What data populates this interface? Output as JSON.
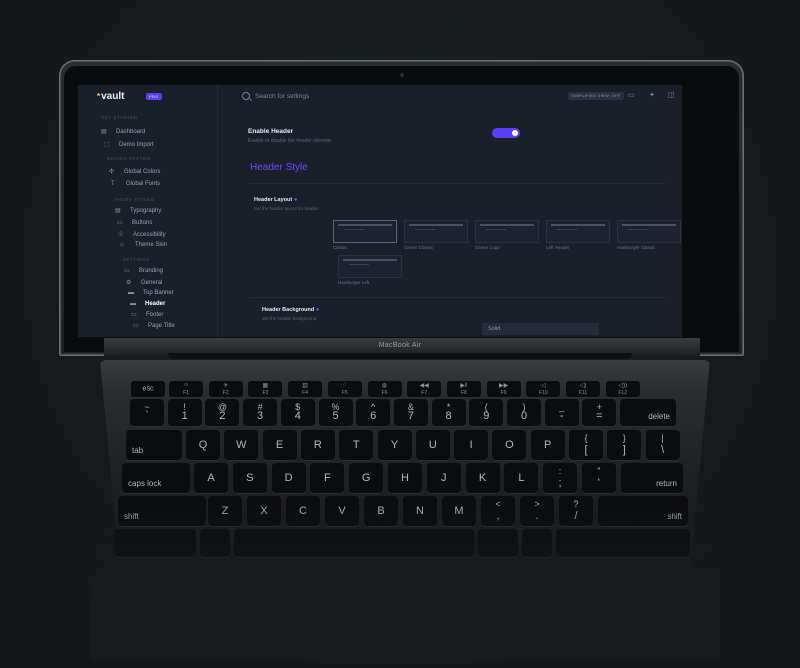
{
  "device": {
    "model_label": "MacBook Air"
  },
  "app": {
    "logo": "vault",
    "logo_star": "*",
    "badge": "PRO",
    "accent": "#5b3ff5"
  },
  "sidebar": {
    "sections": [
      {
        "title": "GET STARTED",
        "items": [
          {
            "label": "Dashboard",
            "icon": "dashboard-icon"
          },
          {
            "label": "Demo Import",
            "icon": "import-icon"
          }
        ]
      },
      {
        "title": "DESIGN SYSTEM",
        "items": [
          {
            "label": "Global Colors",
            "icon": "palette-icon"
          },
          {
            "label": "Global Fonts",
            "icon": "font-icon"
          }
        ]
      },
      {
        "title": "THEME STYLES",
        "items": [
          {
            "label": "Typography",
            "icon": "typography-icon"
          },
          {
            "label": "Buttons",
            "icon": "button-icon"
          },
          {
            "label": "Accessibility",
            "icon": "accessibility-icon"
          },
          {
            "label": "Theme Skin",
            "icon": "skin-icon"
          }
        ]
      },
      {
        "title": "SETTINGS",
        "items": [
          {
            "label": "Branding",
            "icon": "branding-icon"
          },
          {
            "label": "General",
            "icon": "general-icon"
          },
          {
            "label": "Top Banner",
            "icon": "banner-icon"
          },
          {
            "label": "Header",
            "icon": "header-icon",
            "active": true
          },
          {
            "label": "Footer",
            "icon": "footer-icon"
          },
          {
            "label": "Page Title",
            "icon": "page-title-icon"
          }
        ]
      }
    ]
  },
  "topbar": {
    "search_placeholder": "Search for settings",
    "simplified_view": "SIMPLIFIED VIEW: OFF"
  },
  "content": {
    "enable_header": {
      "label": "Enable Header",
      "desc": "Enable or disable the header sitewide",
      "on": true
    },
    "section_title": "Header Style",
    "header_layout": {
      "label": "Header Layout",
      "desc": "Set the header layout for header"
    },
    "layouts": [
      "Classic",
      "Center Classic",
      "Center Logo",
      "Left Header",
      "Hamburger Classic",
      "Hamburger Center",
      "Hamburger Left"
    ],
    "header_background": {
      "label": "Header Background",
      "desc": "Set the header background",
      "value": "Solid"
    }
  },
  "keyboard": {
    "function_row": [
      {
        "label": "esc"
      },
      {
        "label": "F1",
        "icon": "brightness-down-icon"
      },
      {
        "label": "F2",
        "icon": "brightness-up-icon"
      },
      {
        "label": "F3",
        "icon": "mission-control-icon"
      },
      {
        "label": "F4",
        "icon": "launchpad-icon"
      },
      {
        "label": "F5",
        "icon": "keyboard-light-down-icon"
      },
      {
        "label": "F6",
        "icon": "keyboard-light-up-icon"
      },
      {
        "label": "F7",
        "icon": "rewind-icon"
      },
      {
        "label": "F8",
        "icon": "play-pause-icon"
      },
      {
        "label": "F9",
        "icon": "fast-forward-icon"
      },
      {
        "label": "F10",
        "icon": "mute-icon"
      },
      {
        "label": "F11",
        "icon": "volume-down-icon"
      },
      {
        "label": "F12",
        "icon": "volume-up-icon"
      }
    ],
    "number_row": [
      [
        "~",
        "`"
      ],
      [
        "!",
        "1"
      ],
      [
        "@",
        "2"
      ],
      [
        "#",
        "3"
      ],
      [
        "$",
        "4"
      ],
      [
        "%",
        "5"
      ],
      [
        "^",
        "6"
      ],
      [
        "&",
        "7"
      ],
      [
        "*",
        "8"
      ],
      [
        "(",
        "9"
      ],
      [
        ")",
        "0"
      ],
      [
        "_",
        "-"
      ],
      [
        "+",
        "="
      ]
    ],
    "delete": "delete",
    "tab": "tab",
    "qwerty_row": [
      "Q",
      "W",
      "E",
      "R",
      "T",
      "Y",
      "U",
      "I",
      "O",
      "P"
    ],
    "bracket_keys": [
      [
        "{",
        "["
      ],
      [
        "}",
        "]"
      ],
      [
        "|",
        "\\"
      ]
    ],
    "caps": "caps lock",
    "home_row": [
      "A",
      "S",
      "D",
      "F",
      "G",
      "H",
      "J",
      "K",
      "L"
    ],
    "home_punct": [
      [
        ":",
        ";"
      ],
      [
        "\"",
        "'"
      ]
    ],
    "return": "return",
    "shift": "shift",
    "bottom_row": [
      "Z",
      "X",
      "C",
      "V",
      "B",
      "N",
      "M"
    ],
    "bottom_punct": [
      [
        "<",
        ","
      ],
      [
        ">",
        "."
      ],
      [
        "?",
        "/"
      ]
    ]
  }
}
